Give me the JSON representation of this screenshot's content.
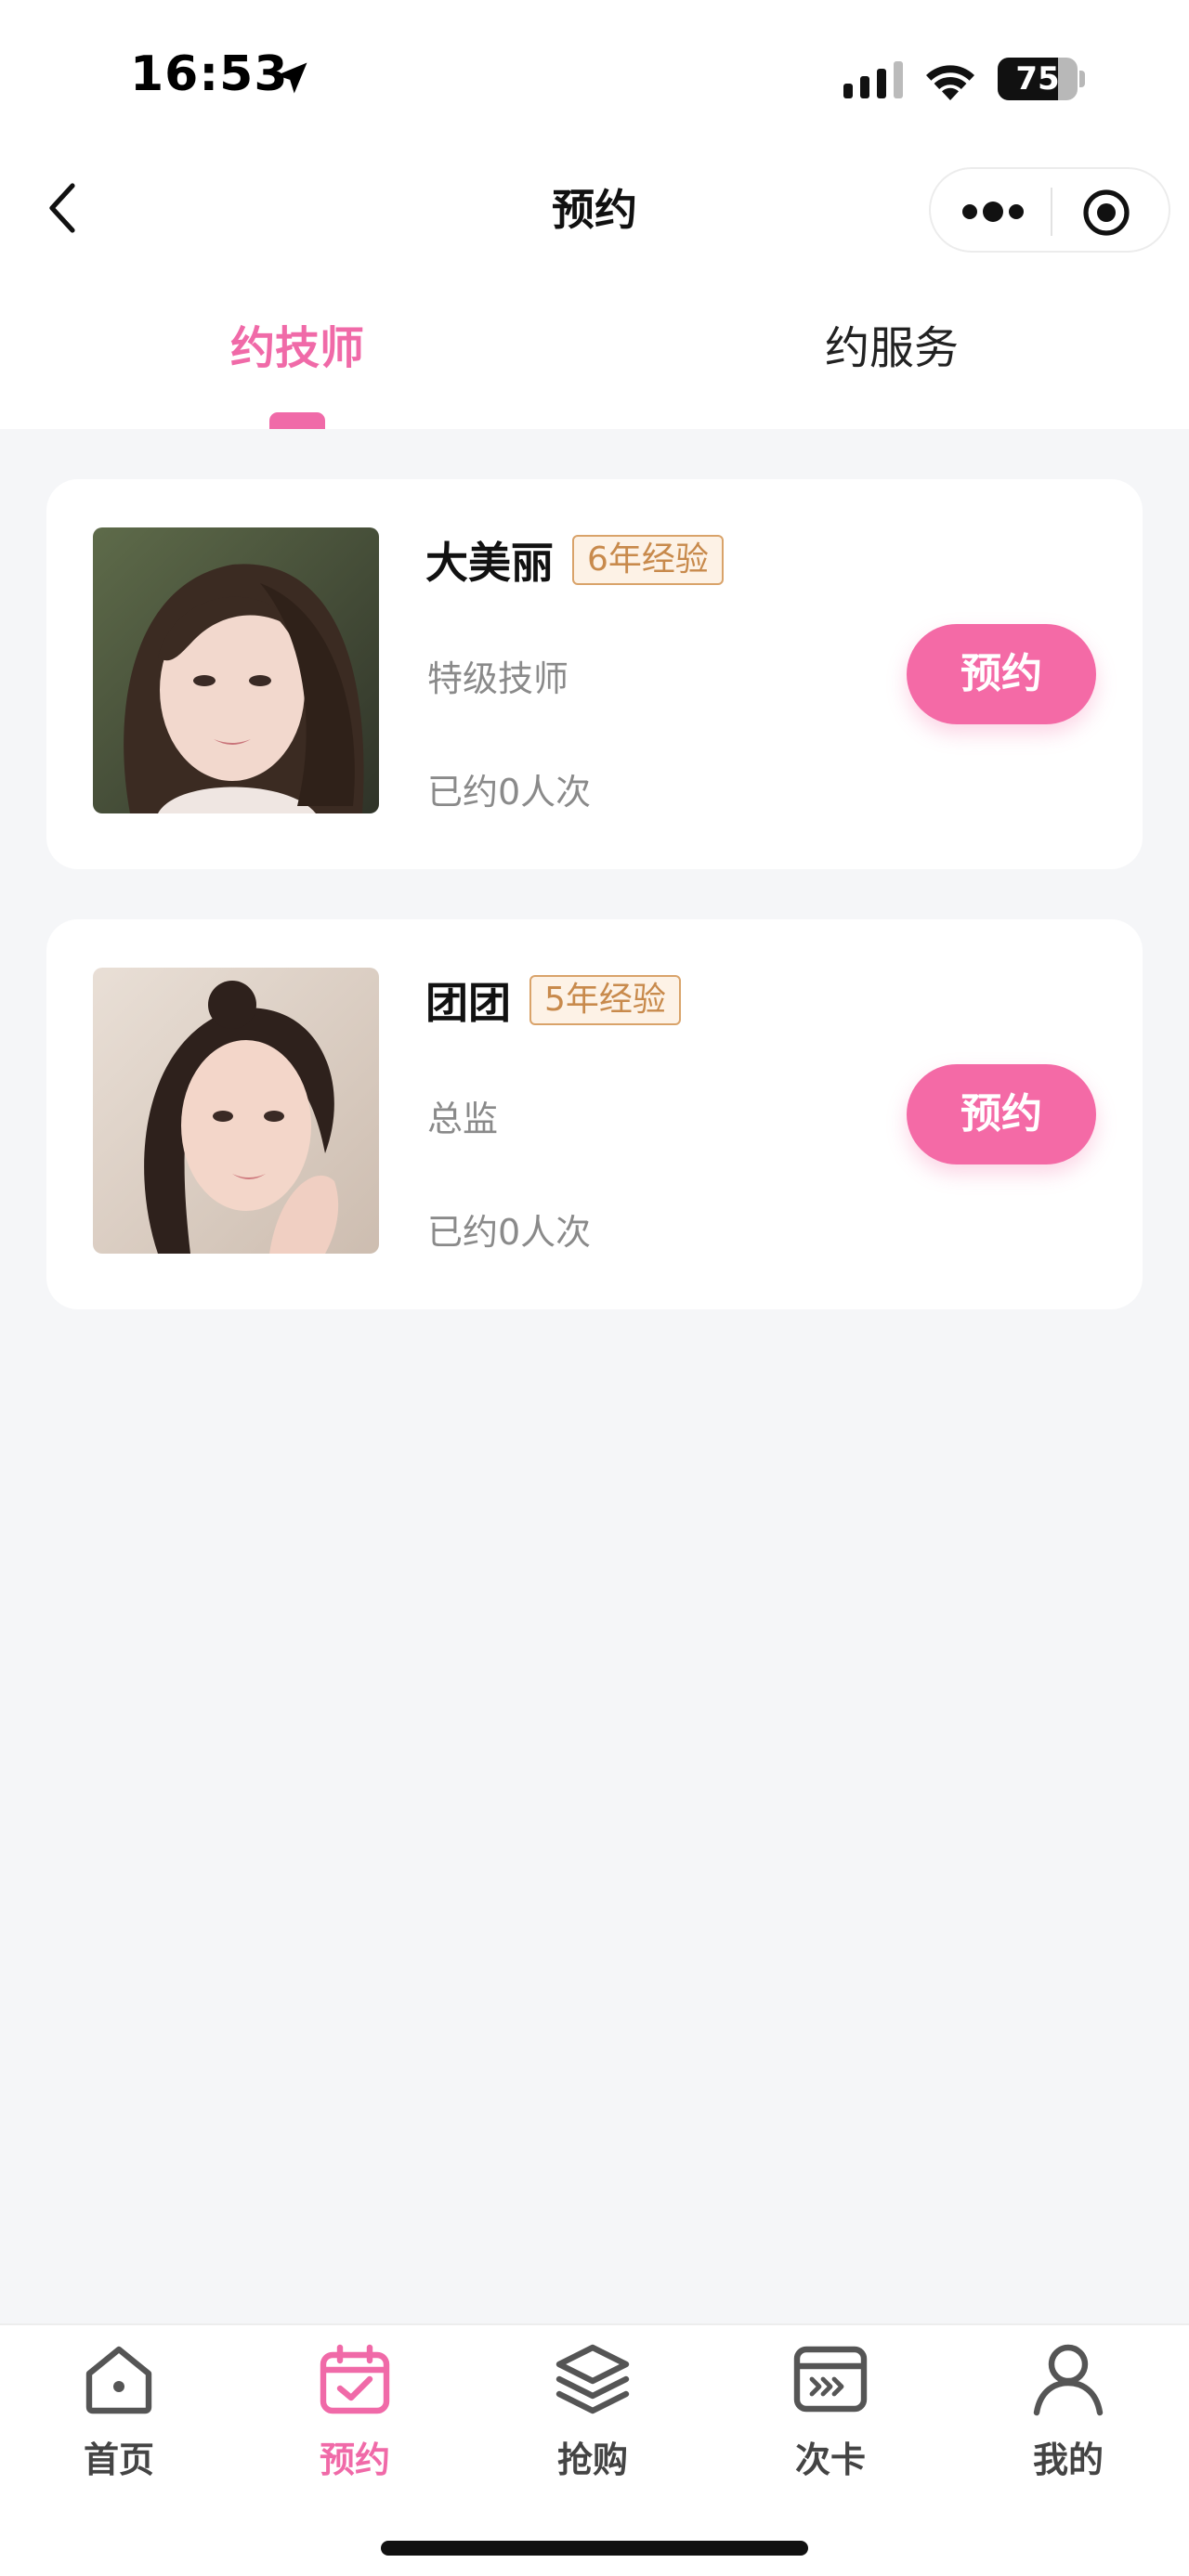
{
  "status_bar": {
    "time": "16:53",
    "battery_level": 75,
    "battery_text": "75"
  },
  "header": {
    "title": "预约"
  },
  "tabs": [
    {
      "label": "约技师",
      "active": true
    },
    {
      "label": "约服务",
      "active": false
    }
  ],
  "technicians": [
    {
      "name": "大美丽",
      "experience": "6年经验",
      "title": "特级技师",
      "booked": "已约0人次",
      "button_label": "预约"
    },
    {
      "name": "团团",
      "experience": "5年经验",
      "title": "总监",
      "booked": "已约0人次",
      "button_label": "预约"
    }
  ],
  "bottom_nav": [
    {
      "label": "首页",
      "icon": "home-icon",
      "active": false
    },
    {
      "label": "预约",
      "icon": "calendar-check-icon",
      "active": true
    },
    {
      "label": "抢购",
      "icon": "layers-icon",
      "active": false
    },
    {
      "label": "次卡",
      "icon": "card-icon",
      "active": false
    },
    {
      "label": "我的",
      "icon": "user-icon",
      "active": false
    }
  ],
  "colors": {
    "accent": "#f06aa8",
    "button": "#f46aa6",
    "badge_border": "#d9a36a",
    "badge_text": "#c88a4c",
    "background": "#f5f6f8"
  }
}
